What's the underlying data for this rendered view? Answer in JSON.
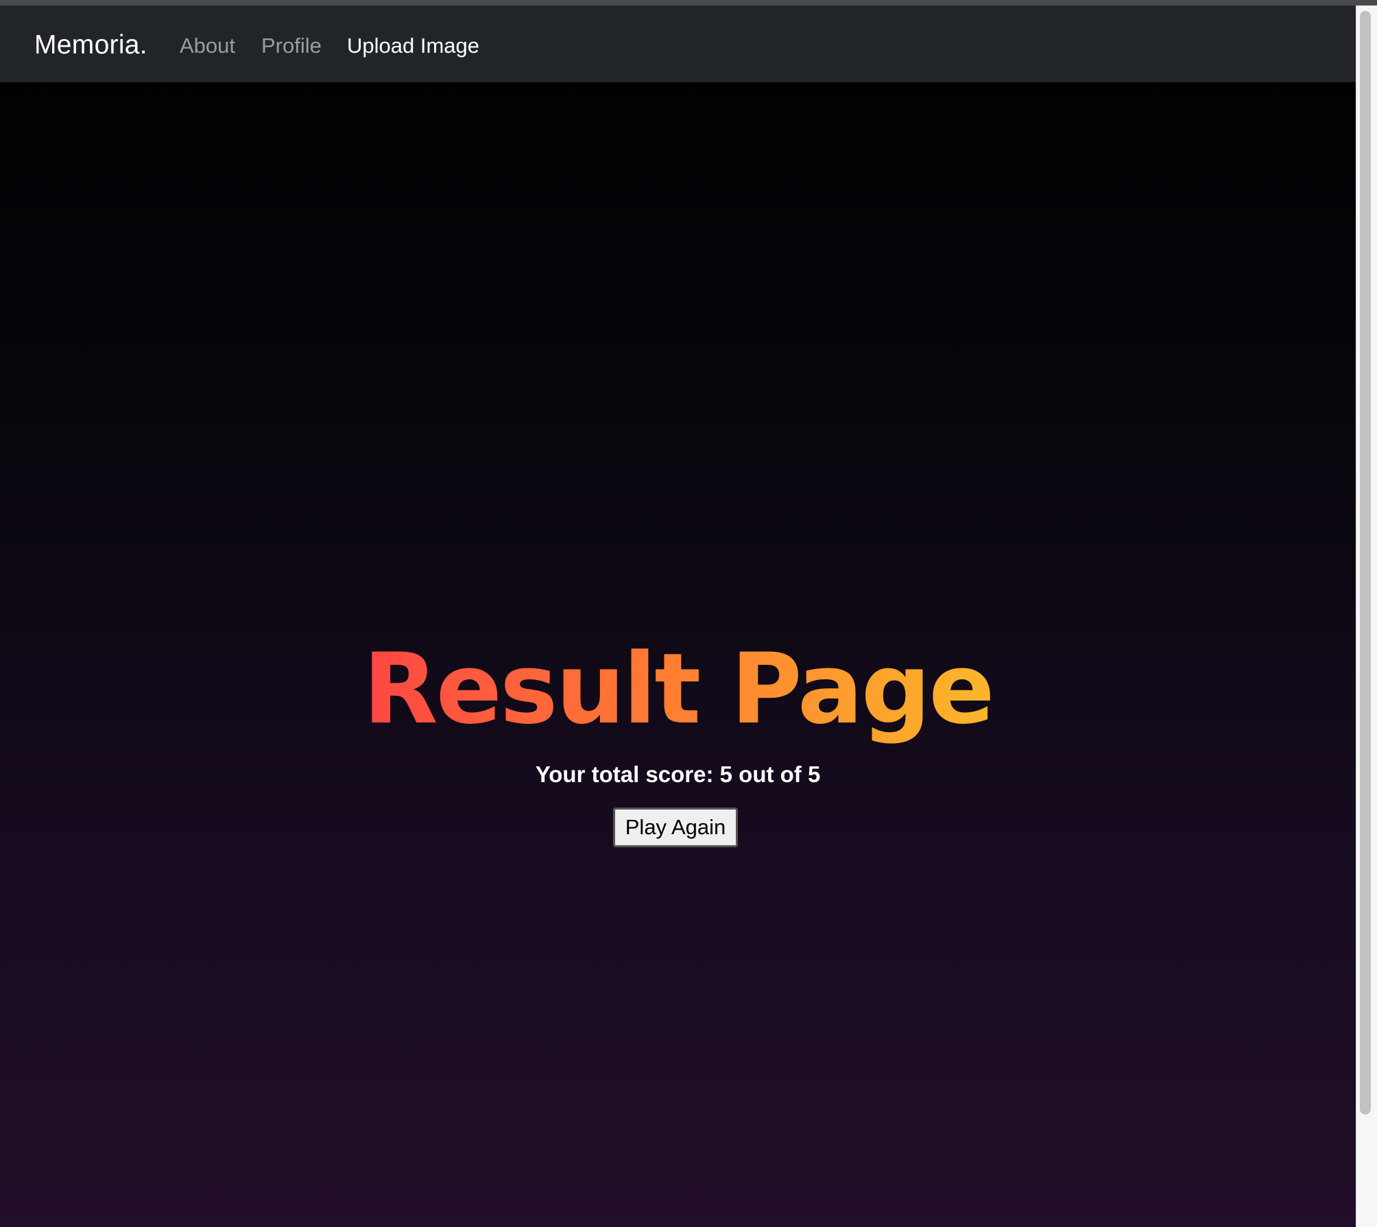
{
  "navbar": {
    "brand": "Memoria.",
    "links": [
      {
        "label": "About",
        "active": false
      },
      {
        "label": "Profile",
        "active": false
      },
      {
        "label": "Upload Image",
        "active": true
      }
    ]
  },
  "main": {
    "title": "Result Page",
    "score_text": "Your total score: 5 out of 5",
    "play_again_label": "Play Again"
  },
  "colors": {
    "navbar_bg": "#212529",
    "title_gradient_start": "#ff4646",
    "title_gradient_end": "#fcb72a",
    "background_top": "#000000",
    "background_bottom": "#220d2a"
  }
}
